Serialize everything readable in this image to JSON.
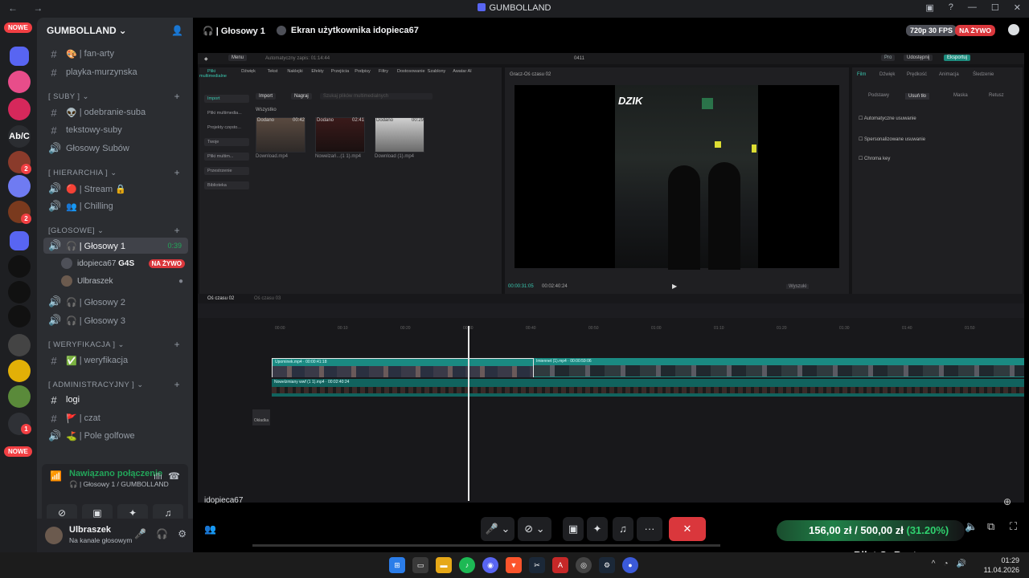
{
  "window": {
    "title": "GUMBOLLAND",
    "nav": "← →",
    "controls": [
      "▣",
      "?",
      "—",
      "☐",
      "✕"
    ]
  },
  "rail": {
    "new_top": "NOWE",
    "new_bottom": "NOWE",
    "abc": "Ab/C",
    "badges": [
      "2",
      "1",
      "2",
      "1"
    ]
  },
  "server": {
    "name": "GUMBOLLAND",
    "chevron": "⌄"
  },
  "channels": [
    {
      "type": "text",
      "icon": "#",
      "emoji": "🎨",
      "label": "| fan-arty"
    },
    {
      "type": "text",
      "icon": "#",
      "label": "playka-murzynska"
    },
    {
      "type": "category",
      "label": "[ SUBY ]"
    },
    {
      "type": "text",
      "icon": "#",
      "emoji": "👽",
      "label": "| odebranie-suba"
    },
    {
      "type": "text",
      "icon": "#",
      "label": "tekstowy-suby"
    },
    {
      "type": "voice",
      "icon": "🔊",
      "label": "Głosowy Subów"
    },
    {
      "type": "category",
      "label": "[ HIERARCHIA ]"
    },
    {
      "type": "voice",
      "icon": "🔊",
      "emoji": "🔴",
      "label": "| Stream 🔒"
    },
    {
      "type": "voice",
      "icon": "🔊",
      "emoji": "👥",
      "label": "| Chilling"
    },
    {
      "type": "category",
      "label": "[GŁOSOWE]"
    },
    {
      "type": "voice-active",
      "icon": "🔊",
      "label": "🎧 | Głosowy 1",
      "time": "0:39"
    },
    {
      "type": "voice",
      "icon": "🔊",
      "label": "🎧 | Głosowy 2"
    },
    {
      "type": "voice",
      "icon": "🔊",
      "label": "🎧 | Głosowy 3"
    },
    {
      "type": "category",
      "label": "[ WERYFIKACJA ]"
    },
    {
      "type": "text",
      "icon": "#",
      "emoji": "✅",
      "label": "| weryfikacja"
    },
    {
      "type": "category",
      "label": "[ ADMINISTRACYJNY ]"
    },
    {
      "type": "text-bright",
      "icon": "#",
      "label": "logi"
    },
    {
      "type": "text",
      "icon": "#",
      "emoji": "🚩",
      "label": "| czat"
    },
    {
      "type": "voice",
      "icon": "🔊",
      "emoji": "⛳",
      "label": "| Pole golfowe"
    }
  ],
  "voice_users": [
    {
      "name": "idopieca67",
      "tag": "G4S",
      "live": "NA ŻYWO"
    },
    {
      "name": "Ulbraszek",
      "status": "●"
    }
  ],
  "voice_panel": {
    "status": "Nawiązano połączenie",
    "location": "🎧 | Głosowy 1 / GUMBOLLAND"
  },
  "user": {
    "name": "Ulbraszek",
    "status": "Na kanale głosowym"
  },
  "stage": {
    "channel": "🎧 | Głosowy 1",
    "screen": "Ekran użytkownika idopieca67",
    "quality": "720p 30 FPS",
    "live": "NA ŻYWO",
    "watcher": "idopieca67"
  },
  "editor": {
    "menu": "Menu",
    "autosave": "Automatyczny zapis: 01:14:44",
    "project_id": "0411",
    "pro": "Pro",
    "share": "Udostępnij",
    "export": "Eksportuj",
    "tools": [
      "Pliki multimedialne",
      "Dźwięk",
      "Tekst",
      "Naklejki",
      "Efekty",
      "Przejścia",
      "Podpisy",
      "Filtry",
      "Dostosowanie",
      "Szablony",
      "Awatar AI"
    ],
    "side_menu": [
      "Import",
      "Pliki multimedia...",
      "Projekty często...",
      "Twoje",
      "Pliki multim...",
      "Przestrzenie",
      "Biblioteka"
    ],
    "import": "Import",
    "record": "Nagraj",
    "search": "Szukaj plików multimedialnych",
    "all": "Wszystko",
    "media": [
      {
        "state": "Dodano",
        "duration": "00:42",
        "name": "Download.mp4"
      },
      {
        "state": "Dodano",
        "duration": "02:41",
        "name": "Nowelzań...(1 1).mp4"
      },
      {
        "state": "Dodano",
        "duration": "00:29",
        "name": "Download (1).mp4"
      }
    ],
    "player_title": "Gracz-Oś czasu 02",
    "video_logo": "DZIK",
    "timecode": "00:00:31:05",
    "duration": "00:02:40:24",
    "ratio": "Wyszuki",
    "right_tabs": [
      "Film",
      "Dźwięk",
      "Prędkość",
      "Animacja",
      "Śledzenie"
    ],
    "right_subtabs": [
      "Podstawy",
      "Usuń tło",
      "Maska",
      "Retusz"
    ],
    "options": [
      "Automatyczne usuwanie",
      "Spersonalizowane usuwanie",
      "Chroma key"
    ],
    "timeline_tab": "Oś czasu 02",
    "timeline_tab2": "Oś czasu 03",
    "clip1": "Upominek.mp4 · 00:00:41:18",
    "clip2": "Imiennet (1).mp4 · 00:00:59:06",
    "clip3": "Nowelzmiany wwf (1 1).mp4 · 00:02:40:24",
    "cover": "Okładka",
    "ruler": [
      "00:00",
      "00:10",
      "00:20",
      "00:30",
      "00:40",
      "00:50",
      "01:00",
      "01:10",
      "01:20",
      "01:30",
      "01:40",
      "01:50"
    ]
  },
  "bottom": {
    "price": "156,00 zł",
    "sep": "/",
    "goal": "500,00 zł",
    "pct": "(31.20%)",
    "bilet": "Bilet OnBeat"
  },
  "taskbar": {
    "search": "Wyszukaj",
    "time": "01:29",
    "date": "11.04.2026"
  }
}
